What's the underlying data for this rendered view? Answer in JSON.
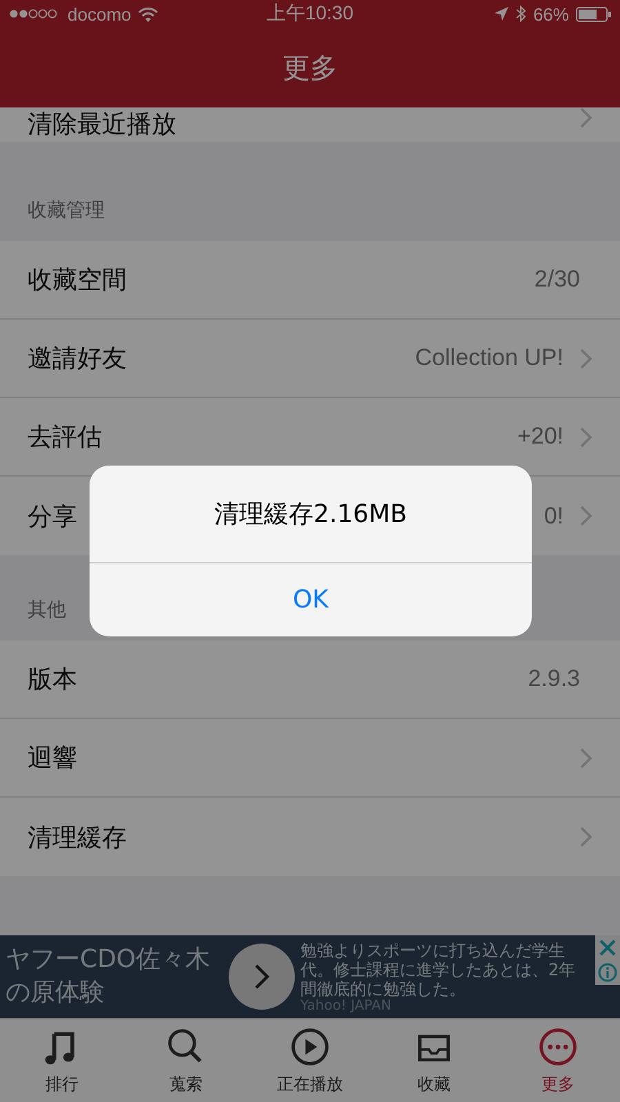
{
  "status_bar": {
    "carrier": "docomo",
    "time": "上午10:30",
    "battery": "66%"
  },
  "nav": {
    "title": "更多"
  },
  "sections": [
    {
      "rows": [
        {
          "label": "清除最近播放",
          "chevron": true
        }
      ]
    },
    {
      "header": "收藏管理",
      "rows": [
        {
          "label": "收藏空間",
          "value": "2/30",
          "chevron": false
        },
        {
          "label": "邀請好友",
          "value": "Collection UP!",
          "chevron": true
        },
        {
          "label": "去評估",
          "value": "+20!",
          "chevron": true
        },
        {
          "label": "分享",
          "value": "0!",
          "chevron": true
        }
      ]
    },
    {
      "header": "其他",
      "rows": [
        {
          "label": "版本",
          "value": "2.9.3",
          "chevron": false
        },
        {
          "label": "迴響",
          "chevron": true
        },
        {
          "label": "清理緩存",
          "chevron": true
        }
      ]
    }
  ],
  "ad": {
    "headline": [
      "ヤフーCDO佐々木",
      "の原体験"
    ],
    "body": [
      "勉強よりスポーツに打ち込んだ学生",
      "代。修士課程に進学したあとは、2年",
      "間徹底的に勉強した。"
    ],
    "source": "Yahoo! JAPAN"
  },
  "tabs": [
    {
      "label": "排行",
      "selected": false
    },
    {
      "label": "蒐索",
      "selected": false
    },
    {
      "label": "正在播放",
      "selected": false
    },
    {
      "label": "收藏",
      "selected": false
    },
    {
      "label": "更多",
      "selected": true
    }
  ],
  "alert": {
    "message": "清理緩存2.16MB",
    "button": "OK"
  }
}
